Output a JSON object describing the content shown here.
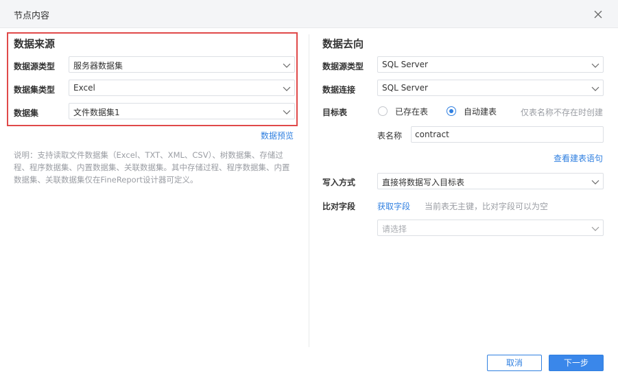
{
  "dialog": {
    "title": "节点内容",
    "close_icon": "close-icon"
  },
  "source": {
    "section_title": "数据来源",
    "datasource_type_label": "数据源类型",
    "datasource_type_value": "服务器数据集",
    "dataset_type_label": "数据集类型",
    "dataset_type_value": "Excel",
    "dataset_label": "数据集",
    "dataset_value": "文件数据集1",
    "preview_link": "数据预览",
    "note": "说明：支持读取文件数据集（Excel、TXT、XML、CSV）、树数据集、存储过程、程序数据集、内置数据集、关联数据集。其中存储过程、程序数据集、内置数据集、关联数据集仅在FineReport设计器可定义。"
  },
  "target": {
    "section_title": "数据去向",
    "datasource_type_label": "数据源类型",
    "datasource_type_value": "SQL Server",
    "connection_label": "数据连接",
    "connection_value": "SQL Server",
    "target_table_label": "目标表",
    "radio_existing": "已存在表",
    "radio_auto_create": "自动建表",
    "radio_selected": "自动建表",
    "auto_create_hint": "仅表名称不存在时创建",
    "table_name_label": "表名称",
    "table_name_value": "contract",
    "view_sql_link": "查看建表语句",
    "write_mode_label": "写入方式",
    "write_mode_value": "直接将数据写入目标表",
    "compare_field_label": "比对字段",
    "get_field_link": "获取字段",
    "compare_hint": "当前表无主键，比对字段可以为空",
    "compare_select_placeholder": "请选择"
  },
  "footer": {
    "cancel_label": "取消",
    "next_label": "下一步"
  },
  "colors": {
    "accent": "#2f7fe0",
    "highlight_border": "#e04848",
    "titlebar_bg": "#f4f5f7"
  }
}
